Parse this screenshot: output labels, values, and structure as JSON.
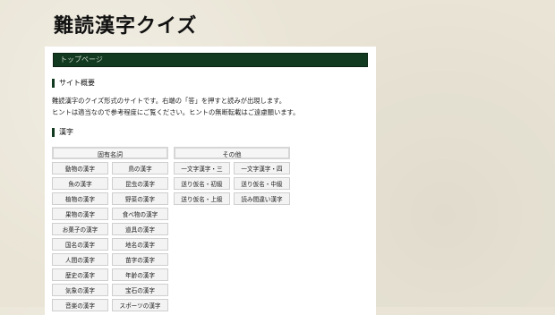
{
  "site_title": "難読漢字クイズ",
  "breadcrumb": "トップページ",
  "overview": {
    "heading": "サイト概要",
    "line1": "難読漢字のクイズ形式のサイトです。右端の「答」を押すと読みが出現します。",
    "line2": "ヒントは適当なので参考程度にご覧ください。ヒントの無断転載はご遠慮願います。"
  },
  "kanji_heading": "漢字",
  "columns": [
    {
      "header": "固有名詞",
      "items": [
        "動物の漢字",
        "鳥の漢字",
        "魚の漢字",
        "昆虫の漢字",
        "植物の漢字",
        "野菜の漢字",
        "果物の漢字",
        "食べ物の漢字",
        "お菓子の漢字",
        "道具の漢字",
        "国名の漢字",
        "地名の漢字",
        "人間の漢字",
        "苗字の漢字",
        "歴史の漢字",
        "年齢の漢字",
        "気象の漢字",
        "宝石の漢字",
        "音楽の漢字",
        "スポーツの漢字"
      ]
    },
    {
      "header": "その他",
      "items": [
        "一文字漢字・三",
        "一文字漢字・四",
        "送り仮名・初級",
        "送り仮名・中級",
        "送り仮名・上級",
        "読み間違い漢字"
      ]
    }
  ],
  "colors": {
    "accent": "#123a20",
    "background": "#e9e4d5"
  }
}
